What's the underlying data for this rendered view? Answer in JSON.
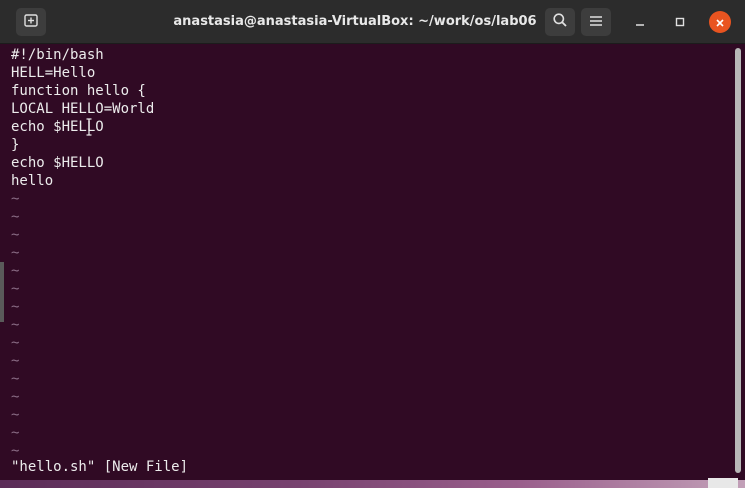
{
  "window": {
    "title": "anastasia@anastasia-VirtualBox: ~/work/os/lab06"
  },
  "titlebar": {
    "icons": {
      "new_tab": "new-tab-icon",
      "search": "search-icon",
      "menu": "hamburger-menu-icon",
      "minimize": "minimize-icon",
      "maximize": "maximize-icon",
      "close": "close-icon"
    }
  },
  "editor": {
    "lines": [
      "#!/bin/bash",
      "HELL=Hello",
      "function hello {",
      "LOCAL HELLO=World",
      "echo $HELLO",
      "}",
      "echo $HELLO",
      "hello"
    ],
    "tilde": "~",
    "status": "\"hello.sh\" [New File]"
  },
  "colors": {
    "terminal_background": "#300a24",
    "titlebar_background": "#2c2c2c",
    "text": "#ececec",
    "close_button": "#e95420"
  }
}
